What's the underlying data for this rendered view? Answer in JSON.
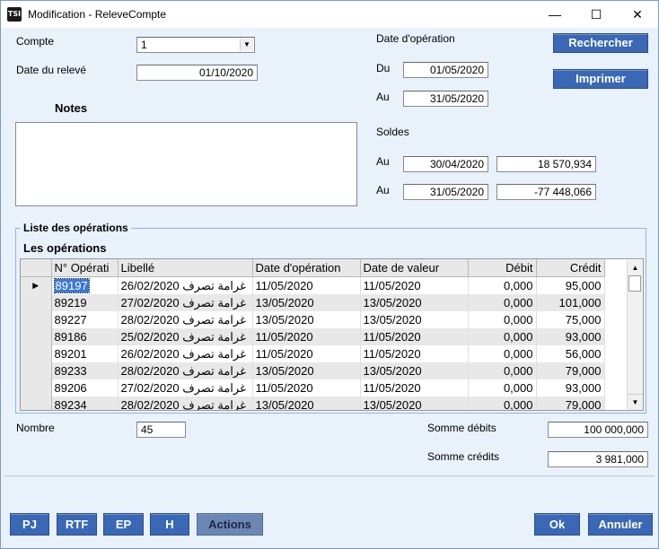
{
  "window": {
    "title": "Modification - ReleveCompte",
    "icon_text": "TSI"
  },
  "form": {
    "compte_label": "Compte",
    "compte_value": "1",
    "date_releve_label": "Date du relevé",
    "date_releve_value": "01/10/2020",
    "date_operation_label": "Date d'opération",
    "du_label": "Du",
    "du_value": "01/05/2020",
    "au_label": "Au",
    "au_value": "31/05/2020",
    "notes_label": "Notes",
    "notes_value": "",
    "soldes_label": "Soldes",
    "solde1_label": "Au",
    "solde1_date": "30/04/2020",
    "solde1_amount": "18 570,934",
    "solde2_label": "Au",
    "solde2_date": "31/05/2020",
    "solde2_amount": "-77 448,066"
  },
  "buttons": {
    "rechercher": "Rechercher",
    "imprimer": "Imprimer",
    "pj": "PJ",
    "rtf": "RTF",
    "ep": "EP",
    "h": "H",
    "actions": "Actions",
    "ok": "Ok",
    "annuler": "Annuler"
  },
  "operations": {
    "group_title": "Liste des opérations",
    "caption": "Les opérations",
    "columns": [
      "N° Opérati",
      "Libellé",
      "Date d'opération",
      "Date de valeur",
      "Débit",
      "Crédit"
    ],
    "rows": [
      {
        "num": "89197",
        "date_lib": "26/02/2020",
        "lib": "غرامة تصرف",
        "date_op": "11/05/2020",
        "date_val": "11/05/2020",
        "debit": "0,000",
        "credit": "95,000"
      },
      {
        "num": "89219",
        "date_lib": "27/02/2020",
        "lib": "غرامة تصرف",
        "date_op": "13/05/2020",
        "date_val": "13/05/2020",
        "debit": "0,000",
        "credit": "101,000"
      },
      {
        "num": "89227",
        "date_lib": "28/02/2020",
        "lib": "غرامة تصرف",
        "date_op": "13/05/2020",
        "date_val": "13/05/2020",
        "debit": "0,000",
        "credit": "75,000"
      },
      {
        "num": "89186",
        "date_lib": "25/02/2020",
        "lib": "غرامة تصرف",
        "date_op": "11/05/2020",
        "date_val": "11/05/2020",
        "debit": "0,000",
        "credit": "93,000"
      },
      {
        "num": "89201",
        "date_lib": "26/02/2020",
        "lib": "غرامة تصرف",
        "date_op": "11/05/2020",
        "date_val": "11/05/2020",
        "debit": "0,000",
        "credit": "56,000"
      },
      {
        "num": "89233",
        "date_lib": "28/02/2020",
        "lib": "غرامة تصرف",
        "date_op": "13/05/2020",
        "date_val": "13/05/2020",
        "debit": "0,000",
        "credit": "79,000"
      },
      {
        "num": "89206",
        "date_lib": "27/02/2020",
        "lib": "غرامة تصرف",
        "date_op": "11/05/2020",
        "date_val": "11/05/2020",
        "debit": "0,000",
        "credit": "93,000"
      },
      {
        "num": "89234",
        "date_lib": "28/02/2020",
        "lib": "غرامة تصرف",
        "date_op": "13/05/2020",
        "date_val": "13/05/2020",
        "debit": "0,000",
        "credit": "79,000"
      }
    ]
  },
  "totals": {
    "nombre_label": "Nombre",
    "nombre_value": "45",
    "somme_debits_label": "Somme débits",
    "somme_debits_value": "100 000,000",
    "somme_credits_label": "Somme crédits",
    "somme_credits_value": "3 981,000"
  }
}
